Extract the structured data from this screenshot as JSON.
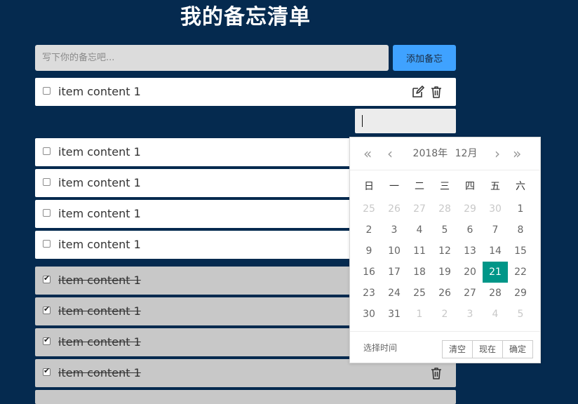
{
  "page": {
    "title": "我的备忘清单"
  },
  "composer": {
    "placeholder": "写下你的备忘吧...",
    "add_label": "添加备忘"
  },
  "active_items": [
    {
      "text": "item content 1",
      "checked": false
    },
    {
      "text": "item content 1",
      "checked": false
    },
    {
      "text": "item content 1",
      "checked": false
    },
    {
      "text": "item content 1",
      "checked": false
    },
    {
      "text": "item content 1",
      "checked": false
    }
  ],
  "done_items": [
    {
      "text": "item content 1",
      "checked": true
    },
    {
      "text": "item content 1",
      "checked": true
    },
    {
      "text": "item content 1",
      "checked": true
    },
    {
      "text": "item content 1",
      "checked": true
    }
  ],
  "datepicker": {
    "year_label": "2018年",
    "month_label": "12月",
    "weekdays": [
      "日",
      "一",
      "二",
      "三",
      "四",
      "五",
      "六"
    ],
    "days": [
      [
        "25",
        "26",
        "27",
        "28",
        "29",
        "30",
        "1"
      ],
      [
        "2",
        "3",
        "4",
        "5",
        "6",
        "7",
        "8"
      ],
      [
        "9",
        "10",
        "11",
        "12",
        "13",
        "14",
        "15"
      ],
      [
        "16",
        "17",
        "18",
        "19",
        "20",
        "21",
        "22"
      ],
      [
        "23",
        "24",
        "25",
        "26",
        "27",
        "28",
        "29"
      ],
      [
        "30",
        "31",
        "1",
        "2",
        "3",
        "4",
        "5"
      ]
    ],
    "selected_day": "21",
    "select_time_label": "选择时间",
    "clear_label": "清空",
    "now_label": "现在",
    "confirm_label": "确定"
  },
  "colors": {
    "background": "#052a4f",
    "accent": "#3fa2ff",
    "selected": "#009688"
  }
}
